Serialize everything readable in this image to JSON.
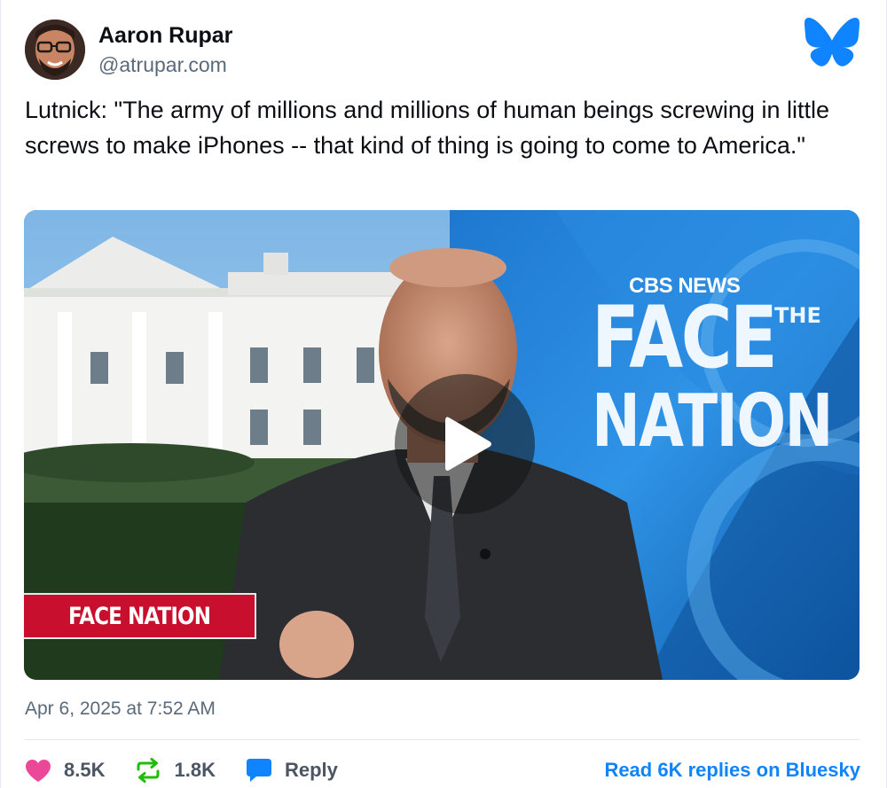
{
  "author": {
    "display_name": "Aaron Rupar",
    "handle": "@atrupar.com"
  },
  "platform_logo": "bluesky-butterfly-icon",
  "post": {
    "text": "Lutnick: \"The army of millions and millions of human beings screwing in little screws to make iPhones -- that kind of thing is going to come to America.\"",
    "timestamp": "Apr 6, 2025 at 7:52 AM"
  },
  "video": {
    "network": "CBS NEWS",
    "show_word_1": "FACE",
    "show_word_the": "THE",
    "show_word_2": "NATION",
    "lower_bug": "FACE NATION",
    "play_icon": "play-icon"
  },
  "footer": {
    "likes": "8.5K",
    "reposts": "1.8K",
    "reply_label": "Reply",
    "read_replies": "Read 6K replies on Bluesky"
  },
  "colors": {
    "like": "#ec4899",
    "repost": "#20bc07",
    "reply": "#1083fe",
    "link": "#1083fe",
    "brand": "#1083fe",
    "bug_red": "#c8102e"
  }
}
